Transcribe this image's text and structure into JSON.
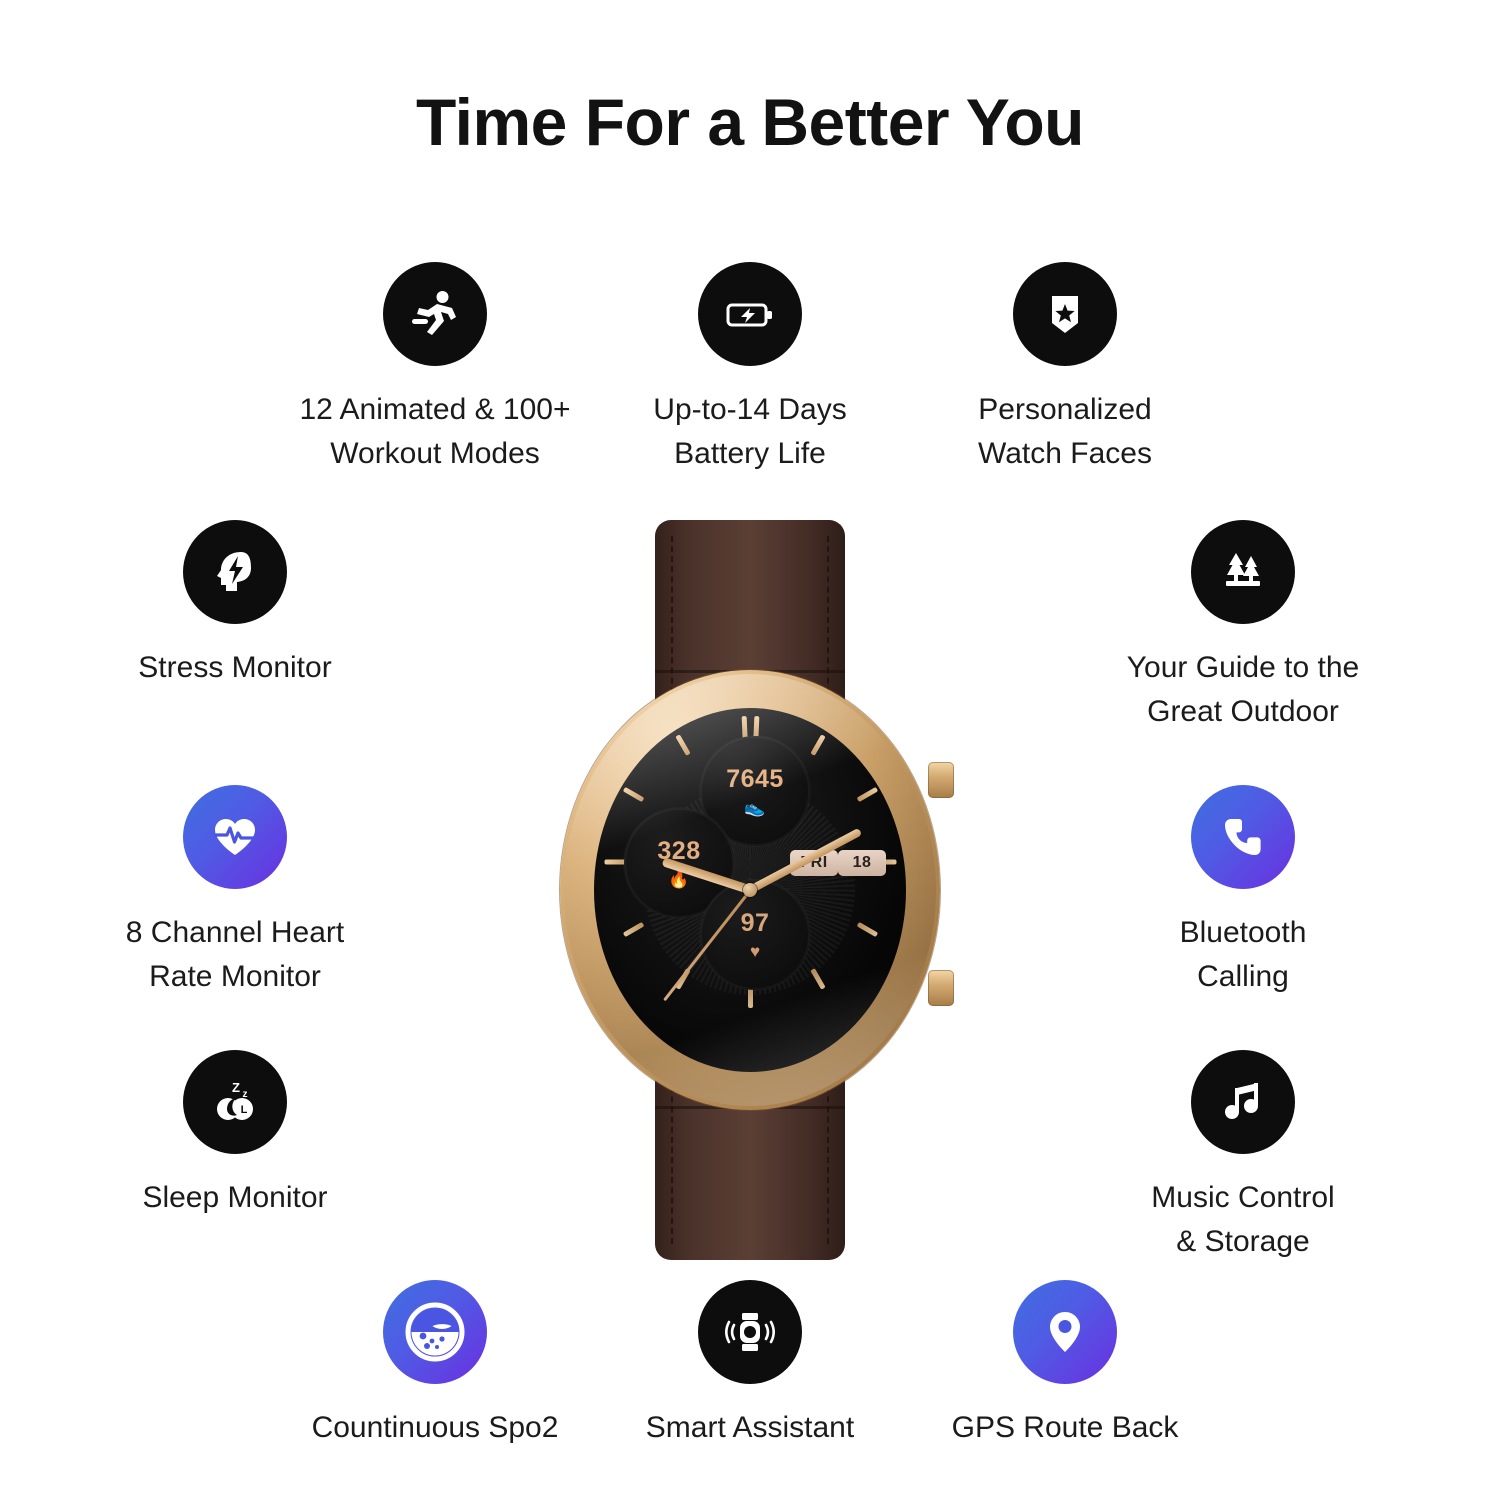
{
  "page": {
    "title": "Time For a Better You",
    "background": "#ffffff",
    "accent_black": "#0d0d0d",
    "accent_gradient_start": "#3e6fe0",
    "accent_gradient_end": "#6b2fe0"
  },
  "features": {
    "workout": {
      "label": "12 Animated & 100+\nWorkout Modes",
      "icon": "running-person-icon",
      "style": "black"
    },
    "battery": {
      "label": "Up-to-14 Days\nBattery Life",
      "icon": "battery-charging-icon",
      "style": "black"
    },
    "faces": {
      "label": "Personalized\nWatch Faces",
      "icon": "shield-star-icon",
      "style": "black"
    },
    "stress": {
      "label": "Stress Monitor",
      "icon": "head-lightning-icon",
      "style": "black"
    },
    "heart": {
      "label": "8 Channel Heart\nRate Monitor",
      "icon": "heart-pulse-icon",
      "style": "gradient"
    },
    "sleep": {
      "label": "Sleep Monitor",
      "icon": "sleep-zzz-icon",
      "style": "black"
    },
    "outdoor": {
      "label": "Your Guide to the\nGreat Outdoor",
      "icon": "pine-trees-icon",
      "style": "black"
    },
    "bluetooth": {
      "label": "Bluetooth\nCalling",
      "icon": "phone-handset-icon",
      "style": "gradient"
    },
    "music": {
      "label": "Music Control\n& Storage",
      "icon": "music-note-icon",
      "style": "black"
    },
    "spo2": {
      "label": "Countinuous Spo2",
      "icon": "blood-oxygen-drop-icon",
      "style": "gradient"
    },
    "assistant": {
      "label": "Smart Assistant",
      "icon": "watch-voice-waves-icon",
      "style": "black"
    },
    "gps": {
      "label": "GPS Route Back",
      "icon": "map-pin-icon",
      "style": "gradient"
    }
  },
  "watch": {
    "case_color": "#d8b07a",
    "strap_color": "#4a322a",
    "dial_color": "#0b0b0b",
    "subdials": [
      {
        "name": "steps",
        "value": "7645",
        "glyph": "👟"
      },
      {
        "name": "calories",
        "value": "328",
        "glyph": "🔥"
      },
      {
        "name": "heart",
        "value": "97",
        "glyph": "♥"
      }
    ],
    "date": {
      "day": "FRI",
      "number": "18"
    }
  }
}
